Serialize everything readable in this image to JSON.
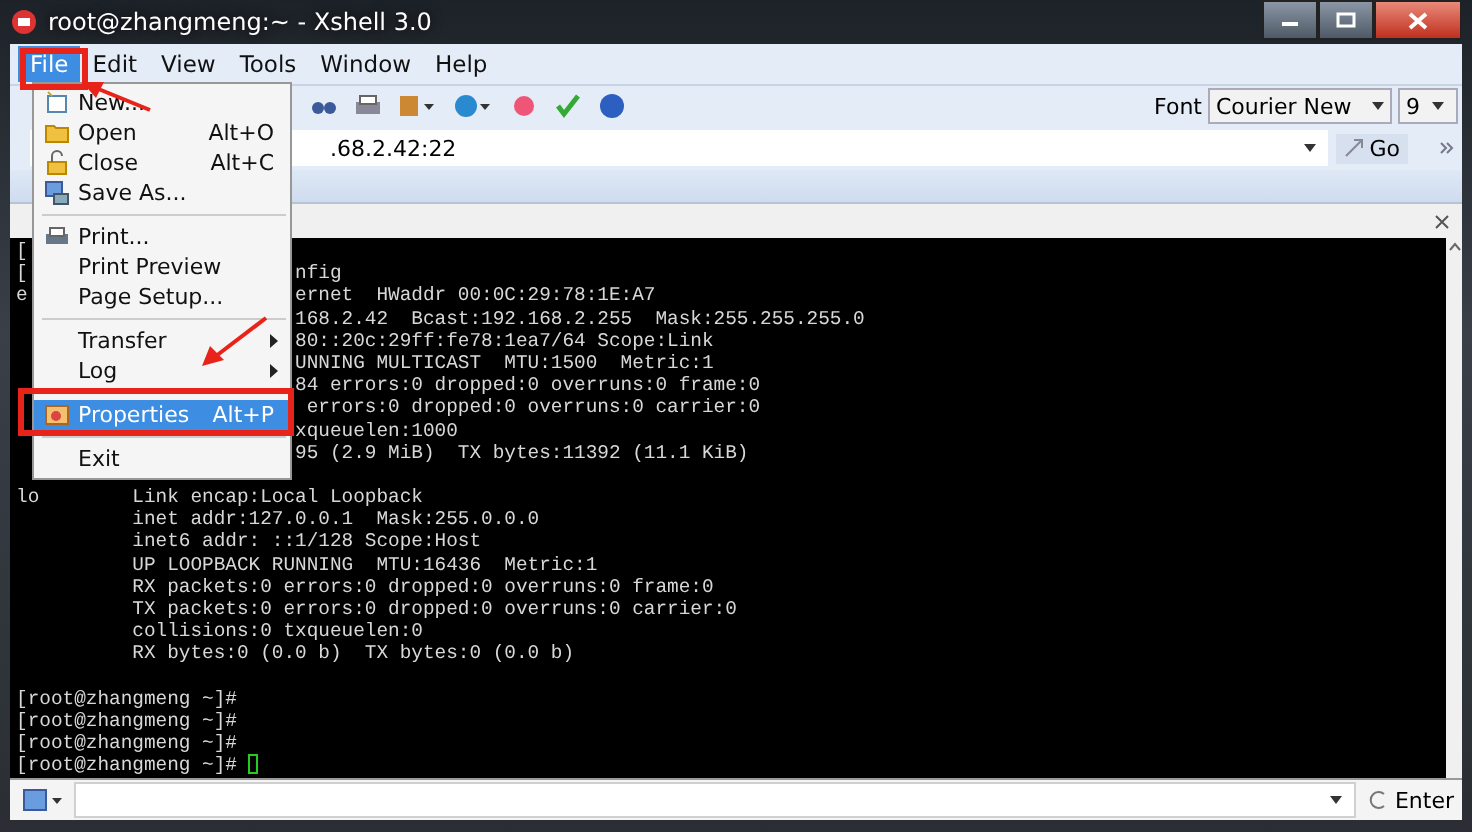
{
  "window": {
    "title": "root@zhangmeng:~ - Xshell 3.0"
  },
  "menu_bar": [
    {
      "label": "File",
      "selected": true
    },
    {
      "label": "Edit",
      "selected": false
    },
    {
      "label": "View",
      "selected": false
    },
    {
      "label": "Tools",
      "selected": false
    },
    {
      "label": "Window",
      "selected": false
    },
    {
      "label": "Help",
      "selected": false
    }
  ],
  "toolbar": {
    "font_label": "Font",
    "font": "Courier New",
    "font_size": "9"
  },
  "address_bar": {
    "value": ".68.2.42:22",
    "go": "Go"
  },
  "terminal": {
    "lines": [
      {
        "kind": "covered",
        "left": "["
      },
      {
        "kind": "covered",
        "left": "[",
        "right": "nfig"
      },
      {
        "kind": "covered",
        "left": "e",
        "right": "ernet  HWaddr 00:0C:29:78:1E:A7"
      },
      {
        "kind": "covered",
        "right": "168.2.42  Bcast:192.168.2.255  Mask:255.255.255.0"
      },
      {
        "kind": "covered",
        "right": "80::20c:29ff:fe78:1ea7/64 Scope:Link"
      },
      {
        "kind": "covered",
        "right": "UNNING MULTICAST  MTU:1500  Metric:1"
      },
      {
        "kind": "covered",
        "right": "84 errors:0 dropped:0 overruns:0 frame:0"
      },
      {
        "kind": "covered",
        "right": " errors:0 dropped:0 overruns:0 carrier:0"
      },
      {
        "kind": "covered",
        "right": "xqueuelen:1000"
      },
      {
        "kind": "covered",
        "right": "95 (2.9 MiB)  TX bytes:11392 (11.1 KiB)"
      },
      {
        "kind": "blank"
      },
      {
        "kind": "full",
        "text": "lo        Link encap:Local Loopback"
      },
      {
        "kind": "full",
        "text": "          inet addr:127.0.0.1  Mask:255.0.0.0"
      },
      {
        "kind": "full",
        "text": "          inet6 addr: ::1/128 Scope:Host"
      },
      {
        "kind": "full",
        "text": "          UP LOOPBACK RUNNING  MTU:16436  Metric:1"
      },
      {
        "kind": "full",
        "text": "          RX packets:0 errors:0 dropped:0 overruns:0 frame:0"
      },
      {
        "kind": "full",
        "text": "          TX packets:0 errors:0 dropped:0 overruns:0 carrier:0"
      },
      {
        "kind": "full",
        "text": "          collisions:0 txqueuelen:0"
      },
      {
        "kind": "full",
        "text": "          RX bytes:0 (0.0 b)  TX bytes:0 (0.0 b)"
      },
      {
        "kind": "blank"
      },
      {
        "kind": "full",
        "text": "[root@zhangmeng ~]#"
      },
      {
        "kind": "full",
        "text": "[root@zhangmeng ~]#"
      },
      {
        "kind": "full",
        "text": "[root@zhangmeng ~]#"
      },
      {
        "kind": "prompt",
        "text": "[root@zhangmeng ~]# ",
        "cursor": true
      }
    ]
  },
  "compose_bar": {
    "button": "Enter"
  },
  "file_menu": {
    "items": [
      {
        "kind": "item",
        "label": "New..."
      },
      {
        "kind": "item",
        "label": "Open",
        "shortcut": "Alt+O"
      },
      {
        "kind": "item",
        "label": "Close",
        "shortcut": "Alt+C"
      },
      {
        "kind": "item",
        "label": "Save As..."
      },
      {
        "kind": "separator"
      },
      {
        "kind": "item",
        "label": "Print..."
      },
      {
        "kind": "item",
        "label": "Print Preview"
      },
      {
        "kind": "item",
        "label": "Page Setup..."
      },
      {
        "kind": "separator"
      },
      {
        "kind": "item",
        "label": "Transfer",
        "submenu": true
      },
      {
        "kind": "item",
        "label": "Log",
        "submenu": true
      },
      {
        "kind": "separator"
      },
      {
        "kind": "item",
        "label": "Properties",
        "shortcut": "Alt+P",
        "selected": true
      },
      {
        "kind": "separator"
      },
      {
        "kind": "item",
        "label": "Exit"
      }
    ]
  }
}
